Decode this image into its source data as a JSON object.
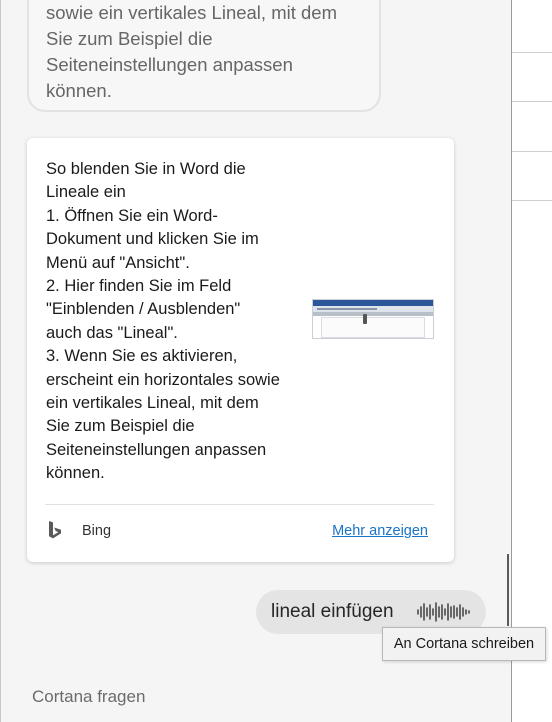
{
  "previous_answer": {
    "lines": [
      "sowie ein vertikales Lineal, mit dem",
      "Sie zum Beispiel die",
      "Seiteneinstellungen anpassen",
      "können."
    ]
  },
  "answer_card": {
    "lines": [
      "So blenden Sie in Word die",
      "Lineale ein",
      "1. Öffnen Sie ein Word-",
      "Dokument und klicken Sie im",
      "Menü auf \"Ansicht\".",
      "2. Hier finden Sie im Feld",
      "\"Einblenden / Ausblenden\"",
      "auch das \"Lineal\".",
      "3. Wenn Sie es aktivieren,",
      "erscheint ein horizontales sowie",
      "ein vertikales Lineal, mit dem",
      "Sie zum Beispiel die",
      "Seiteneinstellungen anpassen",
      "können."
    ],
    "source_icon": "bing-logo-icon",
    "source_label": "Bing",
    "more_link": "Mehr anzeigen"
  },
  "user_message": {
    "text": "lineal einfügen",
    "icon": "voice-waveform-icon"
  },
  "tooltip": {
    "text": "An Cortana schreiben"
  },
  "input": {
    "placeholder": "Cortana fragen"
  },
  "colors": {
    "link": "#1a73c7",
    "bing_logo": "#5a5a5a"
  }
}
